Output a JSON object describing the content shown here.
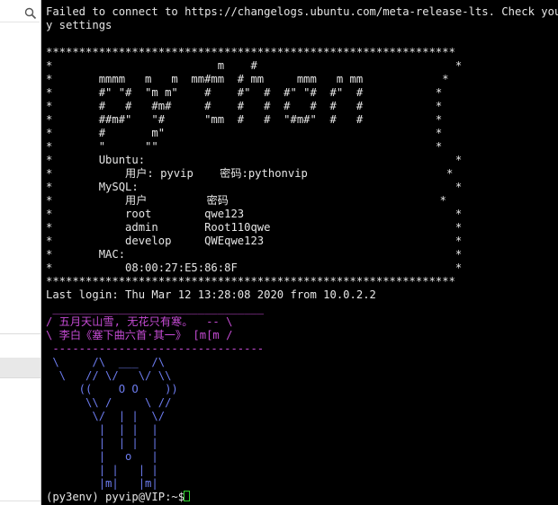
{
  "terminal": {
    "banner": {
      "error_line1": "Failed to connect to https://changelogs.ubuntu.com/meta-release-lts. Check your In",
      "error_line2": "y settings",
      "border": "**************************************************************",
      "art1": "*                         m    #                              *",
      "art2": "*       mmmm   m   m  mm#mm  # mm     mmm   m mm            *",
      "art3": "*       #\" \"#  \"m m\"    #    #\"  #  #\" \"#  #\"  #           *",
      "art4": "*       #   #   #m#     #    #   #  #   #  #   #           *",
      "art5": "*       ##m#\"   \"#      \"mm  #   #  \"#m#\"  #   #           *",
      "art6": "*       #       m\"                                         *",
      "art7": "*       \"      \"\"                                          *",
      "ubuntu_label": "*       Ubuntu:                                               *",
      "ubuntu_user": "*           用户: pyvip    密码:pythonvip                     *",
      "mysql_label": "*       MySQL:                                                *",
      "mysql_header": "*           用户         密码                                *",
      "mysql_row1": "*           root        qwe123                                *",
      "mysql_row2": "*           admin       Root110qwe                            *",
      "mysql_row3": "*           develop     QWEqwe123                             *",
      "mac_label": "*       MAC:                                                  *",
      "mac_value": "*           08:00:27:E5:86:8F                                 *",
      "border_bottom": "**************************************************************"
    },
    "last_login": "Last login: Thu Mar 12 13:28:08 2020 from 10.0.2.2",
    "poem": {
      "top": " ________________________________",
      "line1": "/ 五月天山雪, 无花只有寒。  -- \\",
      "line2": "\\ 李白《塞下曲六首·其一》 [m[m /",
      "bottom": " --------------------------------"
    },
    "cow": [
      " \\     /\\  ___  /\\",
      "  \\   // \\/   \\/ \\\\",
      "     ((    O O    ))",
      "      \\\\ /     \\ //",
      "       \\/  | |  \\/",
      "        |  | |  |",
      "        |  | |  |",
      "        |   o   |",
      "        | |   | |",
      "        |m|   |m|"
    ],
    "prompt": "(py3env) pyvip@VIP:~$ "
  },
  "colors": {
    "terminal_bg": "#000000",
    "text": "#e6e6e6",
    "poem": "#c54bd4",
    "cow": "#6d7cf0",
    "cursor": "#2fd12f"
  }
}
